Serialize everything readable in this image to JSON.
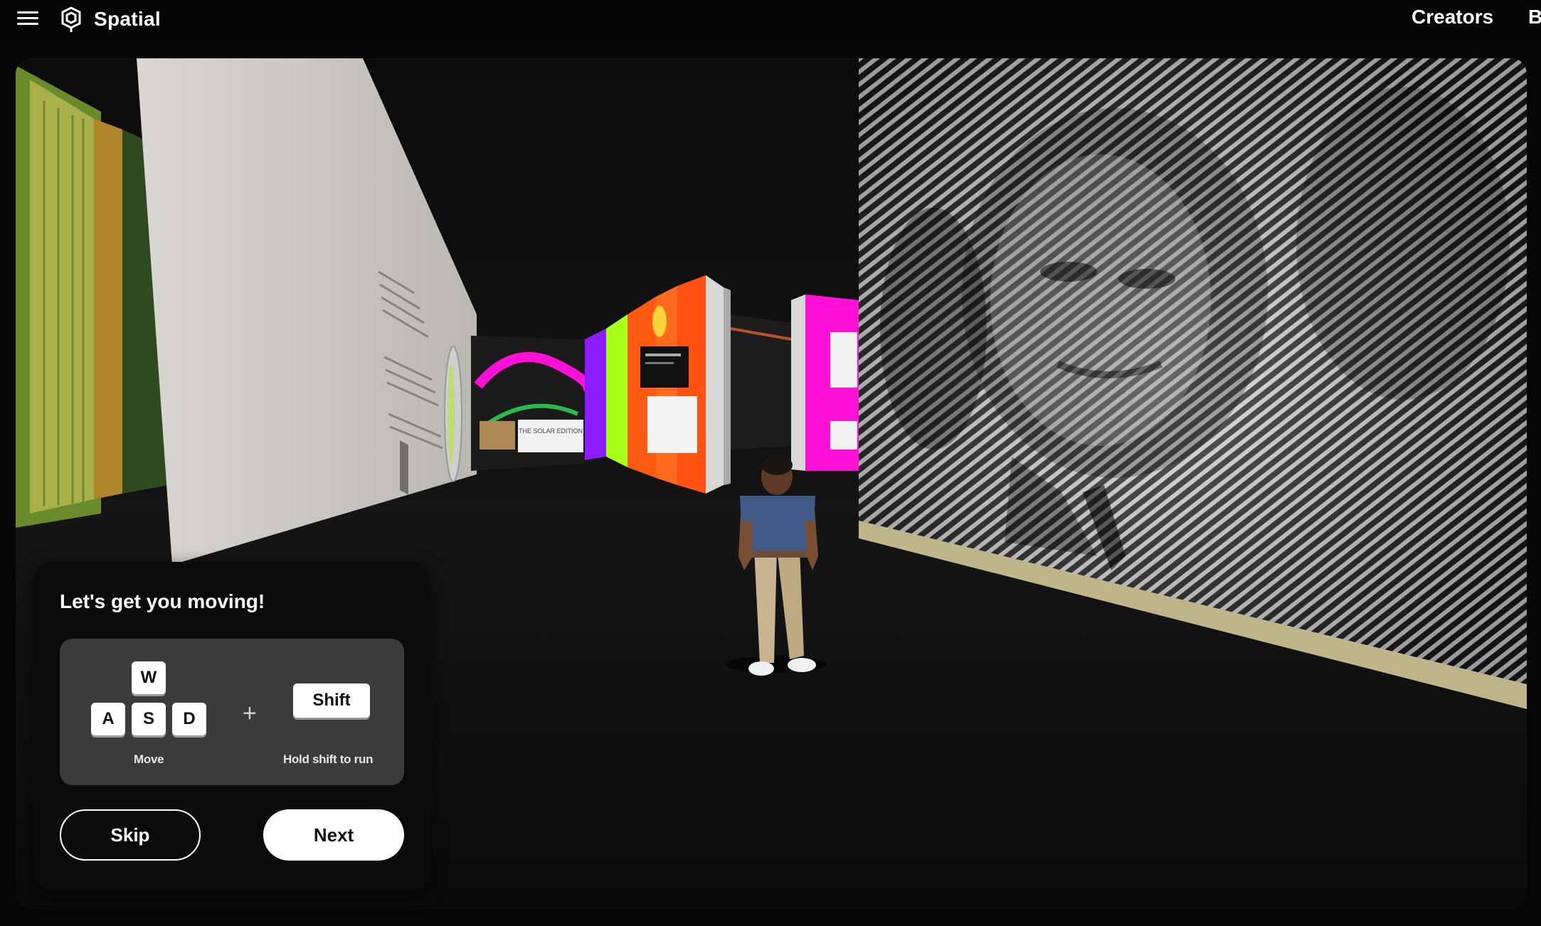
{
  "app": {
    "name": "Spatial",
    "nav": {
      "creators": "Creators",
      "b": "B"
    }
  },
  "scene": {
    "poster_small_text": "THE SOLAR EDITION",
    "colors": {
      "magenta": "#ff10d8",
      "lime": "#a8ff1c",
      "orange": "#ff5a12",
      "purple": "#8a1cff",
      "floor": "#0d0d0d"
    }
  },
  "onboarding": {
    "title": "Let's get you moving!",
    "keys": {
      "w": "W",
      "a": "A",
      "s": "S",
      "d": "D",
      "shift": "Shift"
    },
    "plus": "+",
    "move_caption": "Move",
    "shift_caption": "Hold shift to run",
    "skip_label": "Skip",
    "next_label": "Next"
  },
  "icons": {
    "menu": "hamburger-menu-icon",
    "logo": "spatial-logo-icon",
    "fullscreen": "fullscreen-icon"
  }
}
